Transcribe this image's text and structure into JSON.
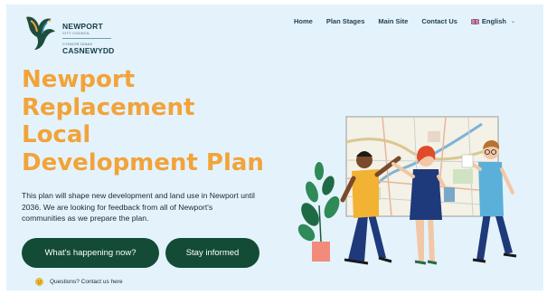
{
  "header": {
    "logo": {
      "line1": "NEWPORT",
      "sub1": "CITY COUNCIL",
      "sub2": "CYNGOR DINAS",
      "line2": "CASNEWYDD"
    },
    "nav": [
      {
        "label": "Home"
      },
      {
        "label": "Plan Stages"
      },
      {
        "label": "Main Site"
      },
      {
        "label": "Contact Us"
      }
    ],
    "language": {
      "label": "English",
      "icon": "uk-flag-icon"
    }
  },
  "hero": {
    "title_lines": [
      "Newport",
      "Replacement",
      "Local",
      "Development Plan"
    ],
    "description": "This plan will shape new development and land use in Newport until 2036. We are looking for feedback from all of Newport's communities as we prepare the plan.",
    "buttons": [
      {
        "label": "What's happening now?"
      },
      {
        "label": "Stay informed"
      }
    ],
    "contact": {
      "label": "Questions? Contact us here",
      "icon": "smiley-icon"
    }
  },
  "colors": {
    "background": "#e4f3fb",
    "title_accent": "#f2a33a",
    "button": "#134b36"
  }
}
